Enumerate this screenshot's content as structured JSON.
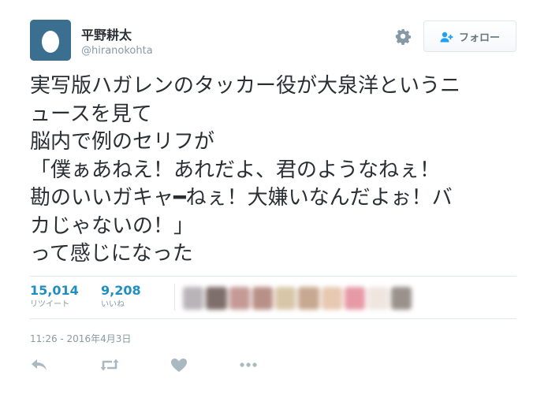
{
  "user": {
    "display_name": "平野耕太",
    "handle": "@hiranokohta"
  },
  "header": {
    "settings_icon": "gear-icon",
    "follow_button_label": "フォロー",
    "follow_icon": "person-plus-icon"
  },
  "tweet": {
    "lines": [
      "実写版ハガレンのタッカー役が大泉洋というニ",
      "ュースを見て",
      "脳内で例のセリフが",
      "「僕ぁあねえ！あれだよ、君のようなねぇ！",
      "勘のいいガキャ━ねぇ！大嫌いなんだよぉ！バ",
      "カじゃないの！」",
      "って感じになった"
    ],
    "timestamp": "11:26 - 2016年4月3日"
  },
  "stats": {
    "retweets": {
      "count": "15,014",
      "label": "リツイート"
    },
    "likes": {
      "count": "9,208",
      "label": "いいね"
    }
  },
  "colors": {
    "accent": "#1f8fc1",
    "muted": "#8899a6",
    "text": "#292f33",
    "border": "#e1e8ed",
    "avatar_bg": "#3b6f8f"
  },
  "actions": [
    "reply-icon",
    "retweet-icon",
    "like-icon",
    "more-icon"
  ]
}
